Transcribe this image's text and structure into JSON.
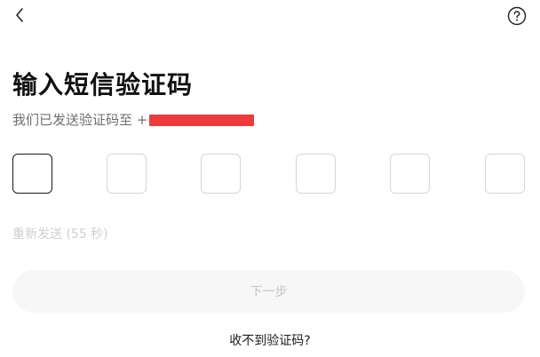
{
  "header": {
    "back_icon": "chevron-left-icon",
    "help_icon": "question-circle-icon"
  },
  "title": "输入短信验证码",
  "subtitle_prefix": "我们已发送验证码至 +",
  "code_input": {
    "length": 6,
    "active_index": 0
  },
  "resend_label": "重新发送 (55 秒)",
  "next_button_label": "下一步",
  "no_code_link": "收不到验证码?",
  "colors": {
    "redaction": "#ef3a3c",
    "disabled_text": "#cfcfcf",
    "button_bg": "#f7f7f7"
  }
}
